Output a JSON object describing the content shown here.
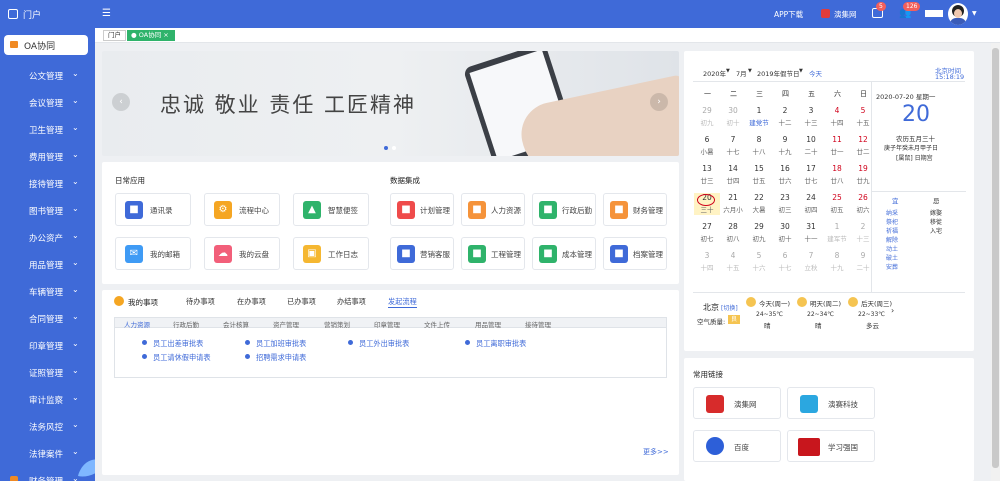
{
  "topbar": {
    "logo_label": "门户",
    "app_download": "APP下载",
    "brand": "演集网",
    "msg_badge": "5",
    "notice_badge": "126"
  },
  "sidebar": {
    "active_label": "OA协同",
    "items": [
      "公文管理",
      "会议管理",
      "卫生管理",
      "费用管理",
      "接待管理",
      "图书管理",
      "办公资产",
      "用品管理",
      "车辆管理",
      "合同管理",
      "印章管理",
      "证照管理",
      "审计监察",
      "法务风控",
      "法律案件",
      "财务管理"
    ]
  },
  "tabs": {
    "home": "门户",
    "active": "OA协同"
  },
  "banner": {
    "slogan": "忠诚 敬业 责任 工匠精神"
  },
  "daily": {
    "title": "日常应用",
    "items": [
      "通讯录",
      "流程中心",
      "智慧便签",
      "我的邮箱",
      "我的云盘",
      "工作日志"
    ]
  },
  "data_integration": {
    "title": "数据集成",
    "items": [
      "计划管理",
      "人力资源",
      "行政后勤",
      "财务管理",
      "营销客服",
      "工程管理",
      "成本管理",
      "档案管理"
    ]
  },
  "matters": {
    "title": "我的事项",
    "tabs": [
      "待办事项",
      "在办事项",
      "已办事项",
      "办结事项",
      "发起流程"
    ],
    "subtabs": [
      "人力资源",
      "行政后勤",
      "会计核算",
      "资产管理",
      "营销策划",
      "印章管理",
      "文件上传",
      "用品管理",
      "接待管理"
    ],
    "flows": [
      "员工出差审批表",
      "员工加班审批表",
      "员工外出审批表",
      "员工离职审批表",
      "员工请休假申请表",
      "招聘需求申请表"
    ],
    "more": "更多>>"
  },
  "calendar": {
    "header": {
      "year": "2020年",
      "month": "7月",
      "holiday": "2019年假节日",
      "today_btn": "今天"
    },
    "beijing_time_label": "北京时间",
    "time": "15:18:19",
    "weekdays": [
      "一",
      "二",
      "三",
      "四",
      "五",
      "六",
      "日"
    ],
    "rows": [
      [
        [
          "29",
          "初九"
        ],
        [
          "30",
          "初十"
        ],
        [
          "1",
          "建党节"
        ],
        [
          "2",
          "十二"
        ],
        [
          "3",
          "十三"
        ],
        [
          "4",
          "十四"
        ],
        [
          "5",
          "十五"
        ]
      ],
      [
        [
          "6",
          "小暑"
        ],
        [
          "7",
          "十七"
        ],
        [
          "8",
          "十八"
        ],
        [
          "9",
          "十九"
        ],
        [
          "10",
          "二十"
        ],
        [
          "11",
          "廿一"
        ],
        [
          "12",
          "廿二"
        ]
      ],
      [
        [
          "13",
          "廿三"
        ],
        [
          "14",
          "廿四"
        ],
        [
          "15",
          "廿五"
        ],
        [
          "16",
          "廿六"
        ],
        [
          "17",
          "廿七"
        ],
        [
          "18",
          "廿八"
        ],
        [
          "19",
          "廿九"
        ]
      ],
      [
        [
          "20",
          "三十"
        ],
        [
          "21",
          "六月小"
        ],
        [
          "22",
          "大暑"
        ],
        [
          "23",
          "初三"
        ],
        [
          "24",
          "初四"
        ],
        [
          "25",
          "初五"
        ],
        [
          "26",
          "初六"
        ]
      ],
      [
        [
          "27",
          "初七"
        ],
        [
          "28",
          "初八"
        ],
        [
          "29",
          "初九"
        ],
        [
          "30",
          "初十"
        ],
        [
          "31",
          "十一"
        ],
        [
          "1",
          "建军节"
        ],
        [
          "2",
          "十三"
        ]
      ],
      [
        [
          "3",
          "十四"
        ],
        [
          "4",
          "十五"
        ],
        [
          "5",
          "十六"
        ],
        [
          "6",
          "十七"
        ],
        [
          "7",
          "立秋"
        ],
        [
          "8",
          "十九"
        ],
        [
          "9",
          "二十"
        ]
      ]
    ],
    "detail": {
      "date": "2020-07-20 星期一",
      "day": "20",
      "lunar": "农历五月三十",
      "ganzhi": "庚子年癸未月甲子日",
      "extra": "[属鼠] 日期宫",
      "yi_label": "宜",
      "ji_label": "忌",
      "yi": [
        "纳采",
        "祭祀",
        "祈福",
        "解除",
        "动土",
        "破土",
        "安葬"
      ],
      "ji": [
        "嫁娶",
        "移徙",
        "入宅"
      ]
    },
    "weather": {
      "city": "北京",
      "city_tag": "[切换]",
      "aqi_label": "空气质量:",
      "aqi_value": "良",
      "days": [
        {
          "name": "今天(周一)",
          "temp": "24~35℃",
          "desc": "晴"
        },
        {
          "name": "明天(周二)",
          "temp": "22~34℃",
          "desc": "晴"
        },
        {
          "name": "后天(周三)",
          "temp": "22~33℃",
          "desc": "多云"
        }
      ]
    }
  },
  "links": {
    "title": "常用链接",
    "items": [
      "演集网",
      "演赛科技",
      "百度",
      "学习强国"
    ]
  }
}
